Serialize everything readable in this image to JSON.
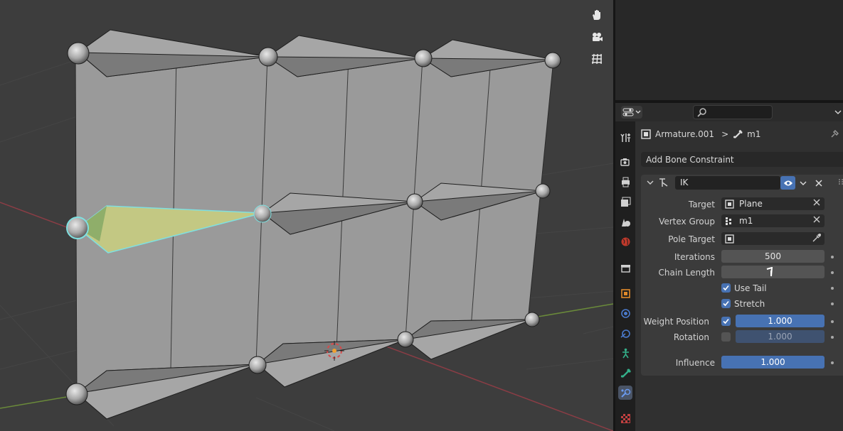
{
  "viewport": {
    "gizmos": [
      "hand-pan-icon",
      "camera-icon",
      "grid-ortho-icon"
    ]
  },
  "properties_header": {
    "editor_icon": "properties-editor-icon",
    "search_placeholder": ""
  },
  "tabs": [
    {
      "name": "tool",
      "icon": "wrench-icon"
    },
    {
      "name": "render",
      "icon": "camera-back-icon"
    },
    {
      "name": "output",
      "icon": "printer-icon"
    },
    {
      "name": "view-layer",
      "icon": "image-stack-icon"
    },
    {
      "name": "scene",
      "icon": "scene-cone-icon"
    },
    {
      "name": "world",
      "icon": "globe-icon"
    },
    {
      "name": "collection",
      "icon": "box-icon"
    },
    {
      "name": "object",
      "icon": "object-square-icon"
    },
    {
      "name": "physics",
      "icon": "physics-circle-icon"
    },
    {
      "name": "object-constraint",
      "icon": "constraint-icon"
    },
    {
      "name": "object-data",
      "icon": "armature-figure-icon"
    },
    {
      "name": "bone",
      "icon": "bone-icon"
    },
    {
      "name": "bone-constraint",
      "icon": "bone-constraint-icon",
      "active": true
    },
    {
      "name": "texture",
      "icon": "checker-icon"
    }
  ],
  "breadcrumb": {
    "object": "Armature.001",
    "separator": ">",
    "bone": "m1"
  },
  "add_constraint_label": "Add Bone Constraint",
  "constraint": {
    "name": "IK",
    "target_label": "Target",
    "target_value": "Plane",
    "vertex_group_label": "Vertex Group",
    "vertex_group_value": "m1",
    "pole_target_label": "Pole Target",
    "pole_target_value": "",
    "iterations_label": "Iterations",
    "iterations_value": "500",
    "chain_length_label": "Chain Length",
    "chain_length_value": "",
    "use_tail_label": "Use Tail",
    "use_tail_checked": true,
    "stretch_label": "Stretch",
    "stretch_checked": true,
    "weight_position_label": "Weight Position",
    "weight_position_checked": true,
    "weight_position_value": "1.000",
    "rotation_label": "Rotation",
    "rotation_checked": false,
    "rotation_value": "1.000",
    "influence_label": "Influence",
    "influence_value": "1.000"
  },
  "colors": {
    "accent_blue": "#4772b3",
    "selected_bone": "#c3c883",
    "selection_outline": "#7fe0e0",
    "x_axis": "#8a3d45",
    "y_axis": "#6a8a3a"
  }
}
